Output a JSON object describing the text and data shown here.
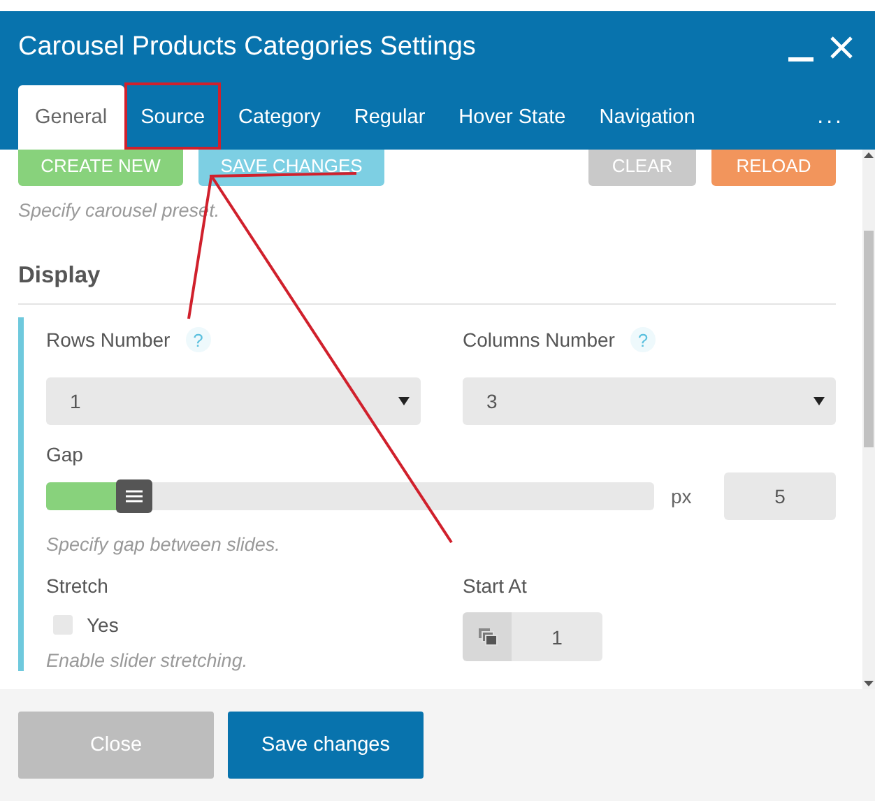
{
  "window": {
    "title": "Carousel Products Categories Settings"
  },
  "tabs": [
    {
      "label": "General",
      "selected": true
    },
    {
      "label": "Source",
      "selected": false
    },
    {
      "label": "Category",
      "selected": false
    },
    {
      "label": "Regular",
      "selected": false
    },
    {
      "label": "Hover State",
      "selected": false
    },
    {
      "label": "Navigation",
      "selected": false
    }
  ],
  "more_tabs": "...",
  "preset": {
    "buttons": [
      {
        "label": "CREATE NEW",
        "kind": "create"
      },
      {
        "label": "SAVE CHANGES",
        "kind": "save"
      },
      {
        "label": "CLEAR",
        "kind": "clear"
      },
      {
        "label": "RELOAD",
        "kind": "reload"
      }
    ],
    "hint": "Specify carousel preset."
  },
  "section": {
    "title": "Display",
    "rows_number": {
      "label": "Rows Number",
      "help": "?",
      "value": "1"
    },
    "columns_number": {
      "label": "Columns Number",
      "help": "?",
      "value": "3"
    },
    "gap": {
      "label": "Gap",
      "level": 0.12,
      "unit": "px",
      "value": "5",
      "hint": "Specify gap between slides."
    },
    "stretch": {
      "label": "Stretch",
      "option": "Yes",
      "checked": false,
      "hint": "Enable slider stretching."
    },
    "start_at": {
      "label": "Start At",
      "value": "1"
    }
  },
  "footer": {
    "buttons": [
      {
        "label": "Close",
        "kind": "secondary"
      },
      {
        "label": "Save changes",
        "kind": "primary"
      }
    ]
  }
}
